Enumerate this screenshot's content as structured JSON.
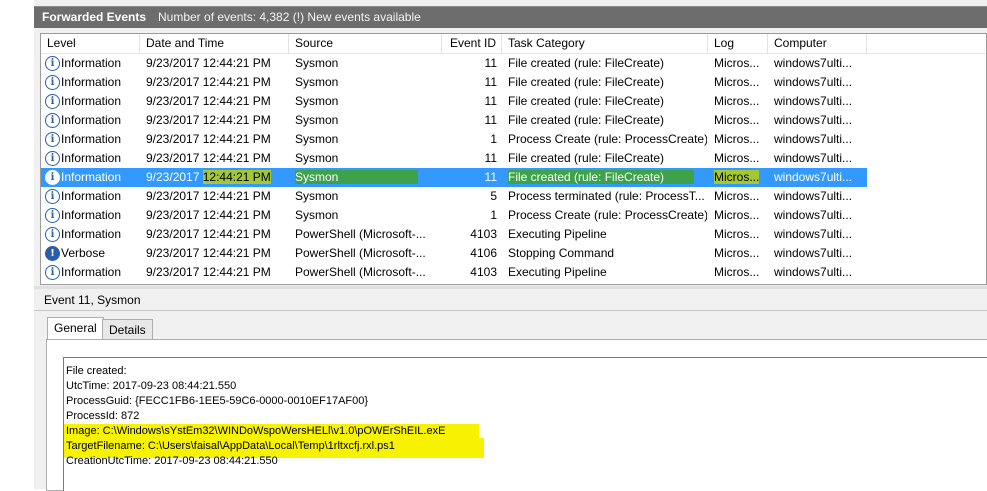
{
  "header": {
    "title": "Forwarded Events",
    "count_text": "Number of events: 4,382 (!) New events available"
  },
  "columns": {
    "level": "Level",
    "date": "Date and Time",
    "source": "Source",
    "event_id": "Event ID",
    "task": "Task Category",
    "log": "Log",
    "computer": "Computer"
  },
  "rows": [
    {
      "level": "Information",
      "icon": "info-icon",
      "date": "9/23/2017 12:44:21 PM",
      "source": "Sysmon",
      "event_id": "11",
      "task": "File created (rule: FileCreate)",
      "log": "Micros...",
      "computer": "windows7ulti..."
    },
    {
      "level": "Information",
      "icon": "info-icon",
      "date": "9/23/2017 12:44:21 PM",
      "source": "Sysmon",
      "event_id": "11",
      "task": "File created (rule: FileCreate)",
      "log": "Micros...",
      "computer": "windows7ulti..."
    },
    {
      "level": "Information",
      "icon": "info-icon",
      "date": "9/23/2017 12:44:21 PM",
      "source": "Sysmon",
      "event_id": "11",
      "task": "File created (rule: FileCreate)",
      "log": "Micros...",
      "computer": "windows7ulti..."
    },
    {
      "level": "Information",
      "icon": "info-icon",
      "date": "9/23/2017 12:44:21 PM",
      "source": "Sysmon",
      "event_id": "11",
      "task": "File created (rule: FileCreate)",
      "log": "Micros...",
      "computer": "windows7ulti..."
    },
    {
      "level": "Information",
      "icon": "info-icon",
      "date": "9/23/2017 12:44:21 PM",
      "source": "Sysmon",
      "event_id": "1",
      "task": "Process Create (rule: ProcessCreate)",
      "log": "Micros...",
      "computer": "windows7ulti..."
    },
    {
      "level": "Information",
      "icon": "info-icon",
      "date": "9/23/2017 12:44:21 PM",
      "source": "Sysmon",
      "event_id": "11",
      "task": "File created (rule: FileCreate)",
      "log": "Micros...",
      "computer": "windows7ulti..."
    },
    {
      "level": "Information",
      "icon": "info-icon",
      "date": "9/23/2017",
      "time": "12:44:21 PM",
      "source": "Sysmon",
      "event_id": "11",
      "task": "File created (rule: FileCreate)",
      "log": "Micros...",
      "computer": "windows7ulti...",
      "selected": true
    },
    {
      "level": "Information",
      "icon": "info-icon",
      "date": "9/23/2017 12:44:21 PM",
      "source": "Sysmon",
      "event_id": "5",
      "task": "Process terminated (rule: ProcessT...",
      "log": "Micros...",
      "computer": "windows7ulti..."
    },
    {
      "level": "Information",
      "icon": "info-icon",
      "date": "9/23/2017 12:44:21 PM",
      "source": "Sysmon",
      "event_id": "1",
      "task": "Process Create (rule: ProcessCreate)",
      "log": "Micros...",
      "computer": "windows7ulti..."
    },
    {
      "level": "Information",
      "icon": "info-icon",
      "date": "9/23/2017 12:44:21 PM",
      "source": "PowerShell (Microsoft-...",
      "event_id": "4103",
      "task": "Executing Pipeline",
      "log": "Micros...",
      "computer": "windows7ulti..."
    },
    {
      "level": "Verbose",
      "icon": "verbose-icon",
      "date": "9/23/2017 12:44:21 PM",
      "source": "PowerShell (Microsoft-...",
      "event_id": "4106",
      "task": "Stopping Command",
      "log": "Micros...",
      "computer": "windows7ulti..."
    },
    {
      "level": "Information",
      "icon": "info-icon",
      "date": "9/23/2017 12:44:21 PM",
      "source": "PowerShell (Microsoft-...",
      "event_id": "4103",
      "task": "Executing Pipeline",
      "log": "Micros...",
      "computer": "windows7ulti..."
    }
  ],
  "detail": {
    "title": "Event 11, Sysmon",
    "tabs": {
      "general": "General",
      "details": "Details"
    },
    "lines": [
      "File created:",
      "UtcTime: 2017-09-23 08:44:21.550",
      "ProcessGuid: {FECC1FB6-1EE5-59C6-0000-0010EF17AF00}",
      "ProcessId: 872",
      "Image: C:\\Windows\\sYstEm32\\WINDoWspoWersHELl\\v1.0\\pOWErShEIL.exE",
      "TargetFilename: C:\\Users\\faisal\\AppData\\Local\\Temp\\1rltxcfj.rxl.ps1",
      "CreationUtcTime: 2017-09-23 08:44:21.550"
    ]
  },
  "colors": {
    "selection": "#3399ff",
    "highlight_yellow": "#f5f500",
    "highlight_green": "#3ea24a",
    "titlebar": "#6d6d6d"
  }
}
